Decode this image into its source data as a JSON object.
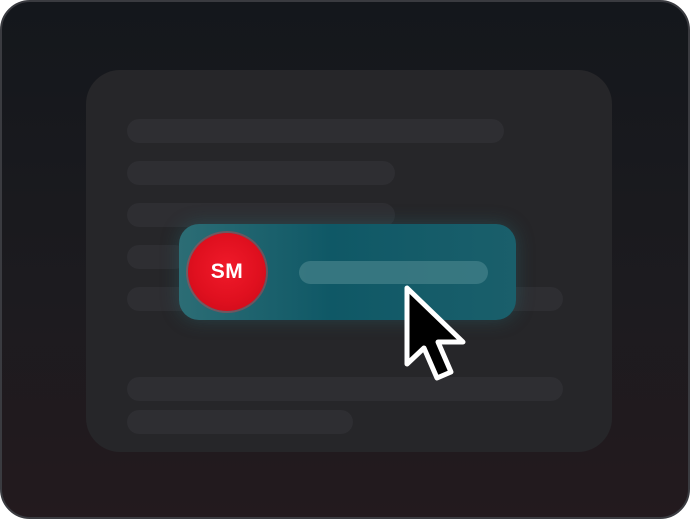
{
  "selected_row": {
    "avatar_initials": "SM"
  },
  "icons": {
    "cursor": "arrow-pointer-icon"
  },
  "colors": {
    "avatar": "#e0101f",
    "selected_row": "#0f5866",
    "background": "#1c1b1f",
    "card": "#262629"
  }
}
